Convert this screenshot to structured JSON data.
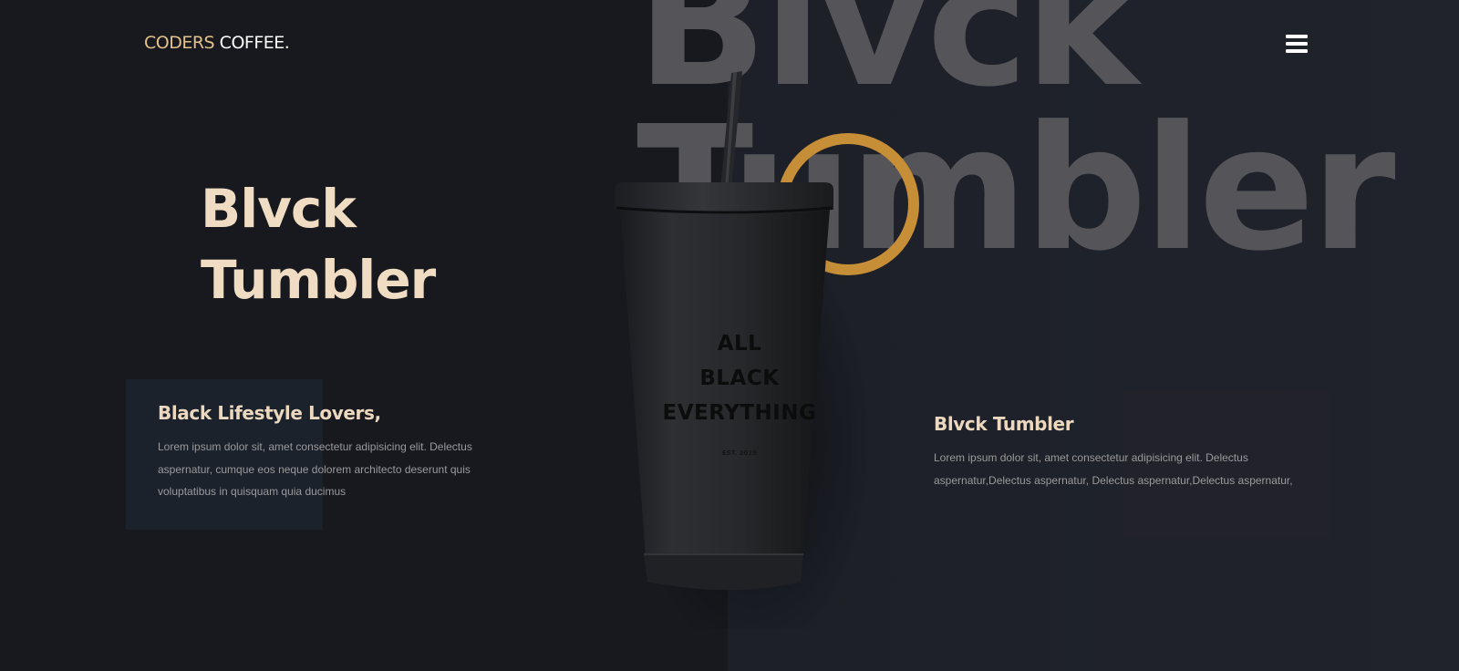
{
  "brand": {
    "part1": "CODERS",
    "part2": "COFFEE."
  },
  "background_text": {
    "line1": "Blvck",
    "line2": "Tumbler"
  },
  "hero": {
    "line1": "Blvck",
    "line2": "Tumbler"
  },
  "left_card": {
    "title": "Black Lifestyle Lovers,",
    "text": "Lorem ipsum dolor sit, amet consectetur adipisicing elit. Delectus aspernatur, cumque eos neque dolorem architecto deserunt quis voluptatibus in quisquam quia ducimus"
  },
  "right_card": {
    "title": "Blvck Tumbler",
    "text": "Lorem ipsum dolor sit, amet consectetur adipisicing elit. Delectus aspernatur,Delectus aspernatur, Delectus aspernatur,Delectus aspernatur,"
  },
  "product": {
    "print_line1": "ALL",
    "print_line2": "BLACK",
    "print_line3": "EVERYTHING",
    "print_small": "EST. 2019"
  },
  "icons": {
    "menu": "hamburger-menu-icon"
  },
  "colors": {
    "accent_gold": "#c68e37",
    "title_cream": "#f0dcc3",
    "background": "#17191e",
    "background_right": "#1f222a"
  }
}
